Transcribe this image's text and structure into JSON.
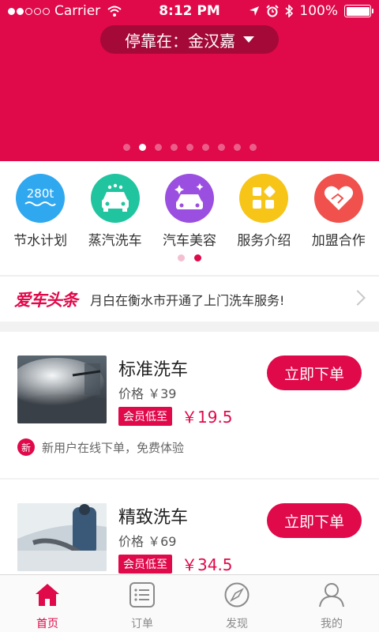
{
  "status_bar": {
    "carrier": "Carrier",
    "time": "8:12 PM",
    "battery": "100%"
  },
  "location": {
    "label": "停靠在：金汉嘉"
  },
  "banner": {
    "dot_count": 9,
    "active_dot": 1
  },
  "services": [
    {
      "label": "节水计划",
      "icon": "water-280t-icon",
      "icon_text": "280t",
      "color": "#2fa8f0"
    },
    {
      "label": "蒸汽洗车",
      "icon": "steam-car-icon",
      "color": "#20c5a0"
    },
    {
      "label": "汽车美容",
      "icon": "car-sparkle-icon",
      "color": "#9b4fe0"
    },
    {
      "label": "服务介绍",
      "icon": "grid-shapes-icon",
      "color": "#f7c518"
    },
    {
      "label": "加盟合作",
      "icon": "handshake-heart-icon",
      "color": "#f0514c"
    }
  ],
  "service_pager": {
    "dot_count": 2,
    "active_dot": 1
  },
  "headline": {
    "logo": "爱车头条",
    "text": "月白在衡水市开通了上门洗车服务!"
  },
  "products": [
    {
      "name": "标准洗车",
      "price": "价格 ￥39",
      "member_badge": "会员低至",
      "member_price": "￥19.5",
      "button": "立即下单",
      "promo_badge": "新",
      "promo_text": "新用户在线下单，免费体验"
    },
    {
      "name": "精致洗车",
      "price": "价格 ￥69",
      "member_badge": "会员低至",
      "member_price": "￥34.5",
      "button": "立即下单"
    }
  ],
  "tabs": [
    {
      "label": "首页",
      "icon": "home-icon",
      "active": true
    },
    {
      "label": "订单",
      "icon": "order-list-icon",
      "active": false
    },
    {
      "label": "发现",
      "icon": "compass-icon",
      "active": false
    },
    {
      "label": "我的",
      "icon": "user-icon",
      "active": false
    }
  ],
  "colors": {
    "brand": "#e0094a"
  }
}
